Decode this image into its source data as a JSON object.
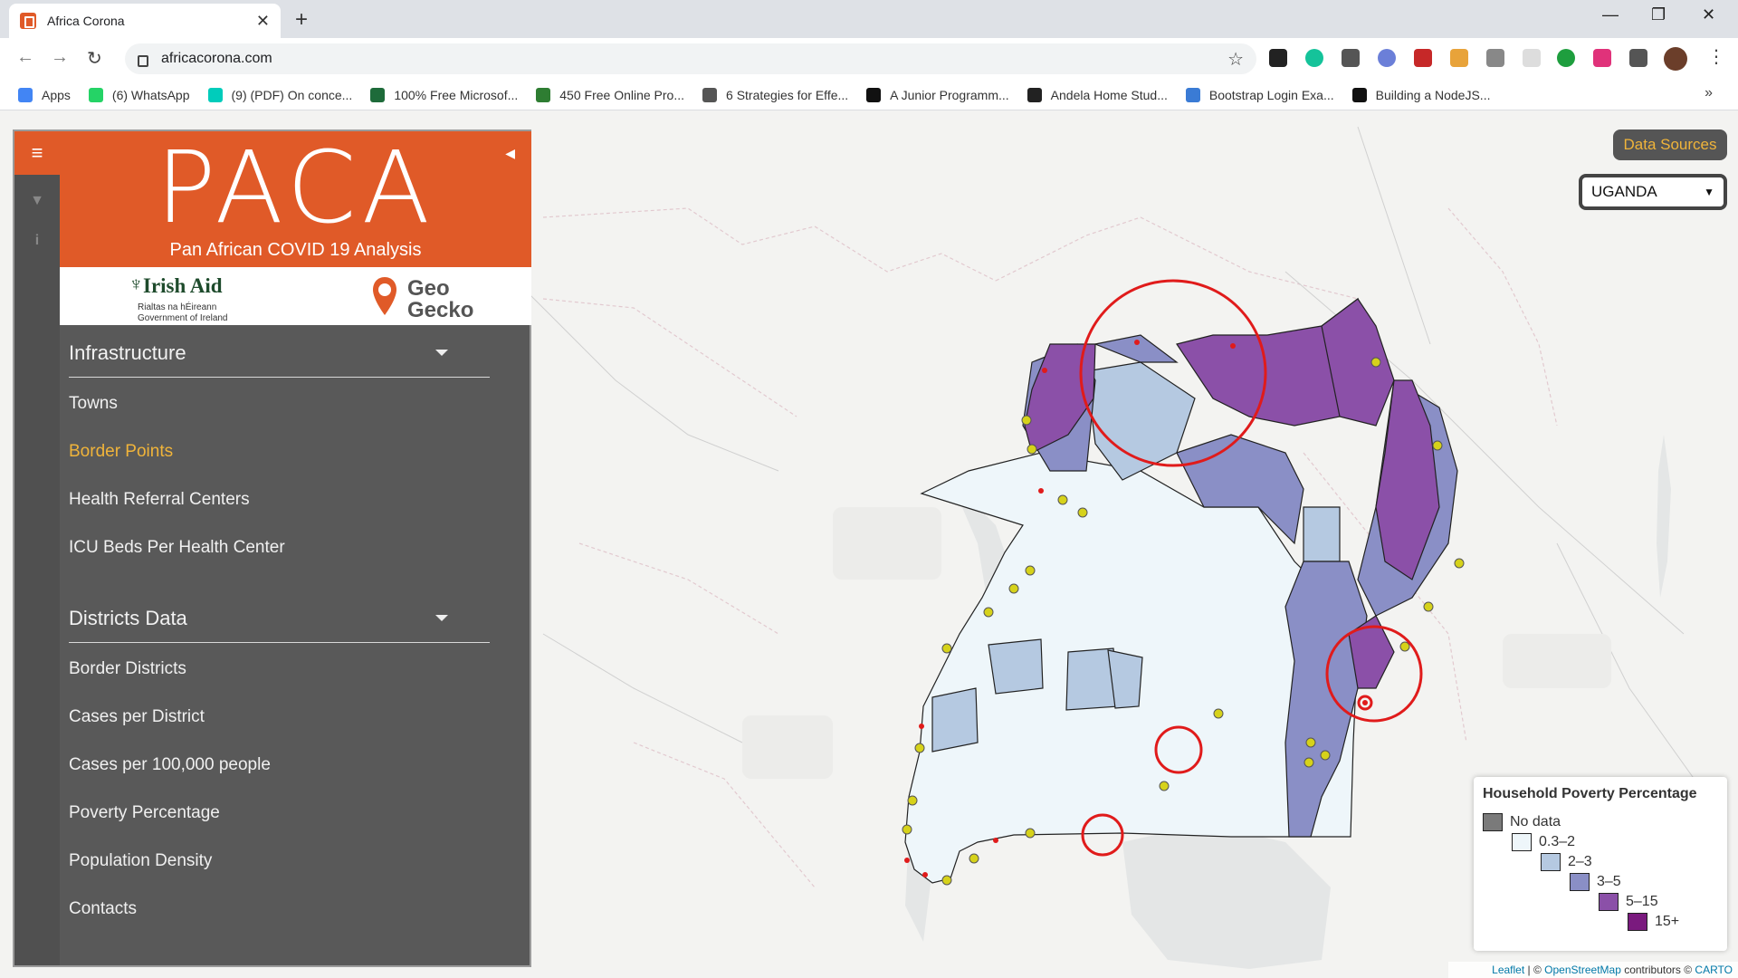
{
  "browser": {
    "tab_title": "Africa Corona",
    "url": "africacorona.com",
    "bookmarks": [
      {
        "label": "Apps",
        "color": "#4285f4"
      },
      {
        "label": "(6) WhatsApp",
        "color": "#25d366"
      },
      {
        "label": "(9) (PDF) On conce...",
        "color": "#00ccbb"
      },
      {
        "label": "100% Free Microsof...",
        "color": "#1e6b3a"
      },
      {
        "label": "450 Free Online Pro...",
        "color": "#2e7d32"
      },
      {
        "label": "6 Strategies for Effe...",
        "color": "#555555"
      },
      {
        "label": "A Junior Programm...",
        "color": "#111111"
      },
      {
        "label": "Andela Home Stud...",
        "color": "#222222"
      },
      {
        "label": "Bootstrap Login Exa...",
        "color": "#3a7bd5"
      },
      {
        "label": "Building a NodeJS...",
        "color": "#111111"
      }
    ],
    "bookmarks_more": "»"
  },
  "sidebar": {
    "title": "PACA",
    "subtitle": "Pan African COVID 19 Analysis",
    "logo_irish_name": "Irish Aid",
    "logo_irish_sub1": "Rialtas na hÉireann",
    "logo_irish_sub2": "Government of Ireland",
    "logo_gecko_1": "Geo",
    "logo_gecko_2": "Gecko",
    "sections": [
      {
        "label": "Infrastructure",
        "items": [
          "Towns",
          "Border Points",
          "Health Referral Centers",
          "ICU Beds Per Health Center"
        ]
      },
      {
        "label": "Districts Data",
        "items": [
          "Border Districts",
          "Cases per District",
          "Cases per 100,000 people",
          "Poverty Percentage",
          "Population Density",
          "Contacts"
        ]
      }
    ],
    "active_item": "Border Points",
    "accent_color": "#e05a28",
    "active_color": "#f0b43a"
  },
  "controls": {
    "data_sources_label": "Data Sources",
    "country_selected": "UGANDA"
  },
  "legend": {
    "title": "Household Poverty Percentage",
    "items": [
      {
        "label": "No data",
        "color": "#7a7a7a"
      },
      {
        "label": "0.3–2",
        "color": "#eef6fa"
      },
      {
        "label": "2–3",
        "color": "#b5c9e1"
      },
      {
        "label": "3–5",
        "color": "#8a8fc6"
      },
      {
        "label": "5–15",
        "color": "#8b50a8"
      },
      {
        "label": "15+",
        "color": "#7a1a7e"
      }
    ]
  },
  "attribution": {
    "leaflet": "Leaflet",
    "sep": " | © ",
    "osm": "OpenStreetMap",
    "contrib": " contributors © ",
    "carto": "CARTO"
  }
}
